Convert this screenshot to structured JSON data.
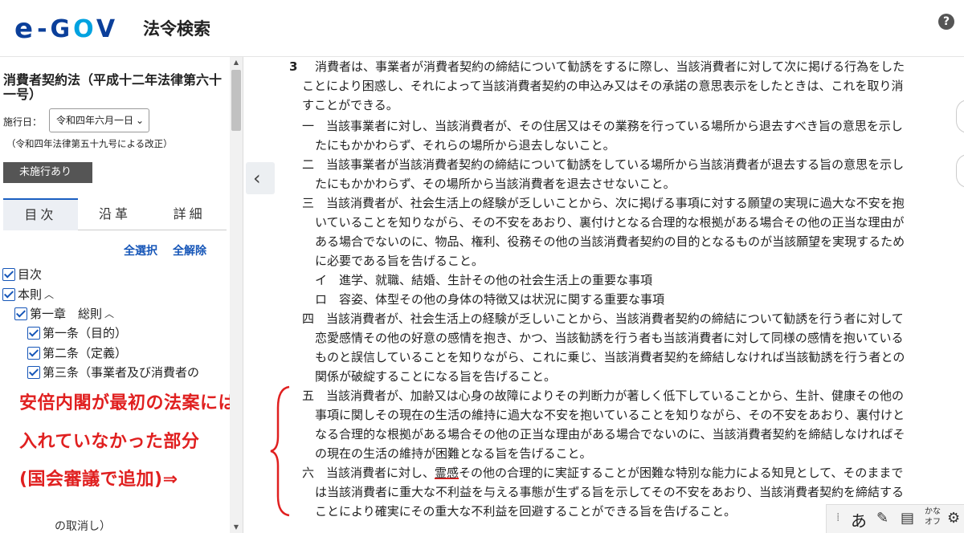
{
  "header": {
    "logo_e": "e",
    "logo_gov_g": "G",
    "logo_gov_o": "O",
    "logo_gov_v": "V",
    "title": "法令検索",
    "help_label": "?"
  },
  "sidebar": {
    "law_title": "消費者契約法（平成十二年法律第六十一号）",
    "date_label": "施行日：",
    "date_value": "令和四年六月一日",
    "amend_note": "（令和四年法律第五十九号による改正）",
    "pending_label": "未施行あり",
    "tabs": [
      {
        "label": "目次",
        "active": true
      },
      {
        "label": "沿革",
        "active": false
      },
      {
        "label": "詳細",
        "active": false
      }
    ],
    "select_all": "全選択",
    "clear_all": "全解除",
    "toc": [
      {
        "label": "目次",
        "caret": ""
      },
      {
        "label": "本則",
        "caret": "^"
      },
      {
        "label": "第一章　総則",
        "caret": "^"
      },
      {
        "label": "第一条（目的）",
        "caret": ""
      },
      {
        "label": "第二条（定義）",
        "caret": ""
      },
      {
        "label": "第三条（事業者及び消費者の",
        "caret": ""
      }
    ],
    "faded_items": [
      "の取消し）"
    ]
  },
  "annotation": {
    "line1": "安倍内閣が最初の法案には",
    "line2": "入れていなかった部分",
    "line3": "(国会審議で追加)⇒"
  },
  "content": {
    "p3_num": "3",
    "lines": [
      "消費者は、事業者が消費者契約の締結について勧誘をするに際し、当該消費者に対して次に掲げる行為をした",
      "ことにより困惑し、それによって当該消費者契約の申込み又はその承諾の意思表示をしたときは、これを取り消",
      "すことができる。",
      "一　当該事業者に対し、当該消費者が、その住居又はその業務を行っている場所から退去すべき旨の意思を示し",
      "たにもかかわらず、それらの場所から退去しないこと。",
      "二　当該事業者が当該消費者契約の締結について勧誘をしている場所から当該消費者が退去する旨の意思を示し",
      "たにもかかわらず、その場所から当該消費者を退去させないこと。",
      "三　当該消費者が、社会生活上の経験が乏しいことから、次に掲げる事項に対する願望の実現に過大な不安を抱",
      "いていることを知りながら、その不安をあおり、裏付けとなる合理的な根拠がある場合その他の正当な理由が",
      "ある場合でないのに、物品、権利、役務その他の当該消費者契約の目的となるものが当該願望を実現するため",
      "に必要である旨を告げること。",
      "イ　進学、就職、結婚、生計その他の社会生活上の重要な事項",
      "ロ　容姿、体型その他の身体の特徴又は状況に関する重要な事項",
      "四　当該消費者が、社会生活上の経験が乏しいことから、当該消費者契約の締結について勧誘を行う者に対して",
      "恋愛感情その他の好意の感情を抱き、かつ、当該勧誘を行う者も当該消費者に対して同様の感情を抱いている",
      "ものと誤信していることを知りながら、これに乗じ、当該消費者契約を締結しなければ当該勧誘を行う者との",
      "関係が破綻することになる旨を告げること。",
      "五　当該消費者が、加齢又は心身の故障によりその判断力が著しく低下していることから、生計、健康その他の",
      "事項に関しその現在の生活の維持に過大な不安を抱いていることを知りながら、その不安をあおり、裏付けと",
      "なる合理的な根拠がある場合その他の正当な理由がある場合でないのに、当該消費者契約を締結しなければそ",
      "の現在の生活の維持が困難となる旨を告げること。",
      "は当該消費者に重大な不利益を与える事態が生ずる旨を示してその不安をあおり、当該消費者契約を締結する",
      "ことにより確実にその重大な不利益を回避することができる旨を告げること。"
    ],
    "six_prefix": "六　当該消費者に対し、",
    "six_underlined": "霊感",
    "six_suffix": "その他の合理的に実証することが困難な特別な能力による知見として、そのままで"
  },
  "ime": {
    "mode": "あ",
    "kana_line1": "かな",
    "kana_line2": "オフ"
  }
}
